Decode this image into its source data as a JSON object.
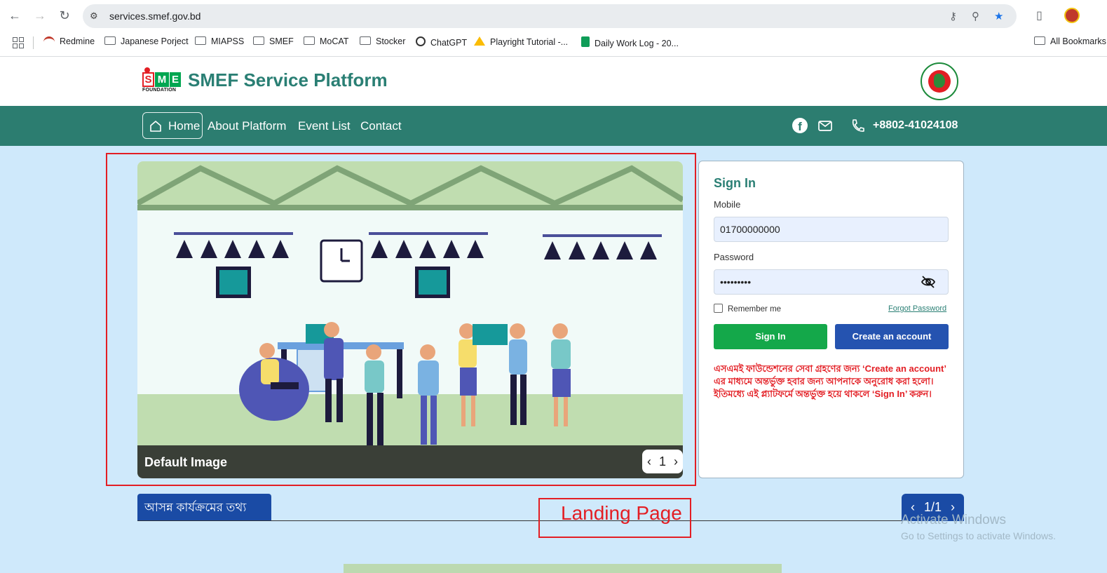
{
  "browser": {
    "url": "services.smef.gov.bd",
    "bookmarks": [
      "Redmine",
      "Japanese Porject",
      "MIAPSS",
      "SMEF",
      "MoCAT",
      "Stocker",
      "ChatGPT",
      "Playright Tutorial -...",
      "Daily Work Log - 20...",
      "All Bookmarks"
    ]
  },
  "header": {
    "logo_text": "SME",
    "logo_sub": "FOUNDATION",
    "title": "SMEF Service Platform"
  },
  "nav": {
    "home": "Home",
    "about": "About Platform",
    "events": "Event List",
    "contact": "Contact",
    "phone": "+8802-41024108"
  },
  "carousel": {
    "caption": "Default Image",
    "page": "1"
  },
  "signin": {
    "title": "Sign In",
    "mobile_label": "Mobile",
    "mobile_value": "01700000000",
    "password_label": "Password",
    "password_value": "•••••••••",
    "remember": "Remember me",
    "forgot": "Forgot Password",
    "signin_button": "Sign In",
    "create_button": "Create an account",
    "notice": "এসএমই ফাউন্ডেশনের সেবা গ্রহণের জন্য ‘Create an account’ এর মাধ্যমে অন্তর্ভুক্ত হবার জন্য আপনাকে অনুরোধ করা হলো। ইতিমধ্যে এই প্ল্যাটফর্মে অন্তর্ভুক্ত হয়ে থাকলে ‘Sign In’ করুন।"
  },
  "upcoming": {
    "tab_label": "আসন্ন কার্যক্রমের তথ্য",
    "pager": "1/1"
  },
  "annotation": "Landing Page",
  "watermark": {
    "line1": "Activate Windows",
    "line2": "Go to Settings to activate Windows."
  },
  "colors": {
    "brand": "#2c7d70",
    "accent_green": "#14a84a",
    "accent_blue": "#2553b0",
    "alert_red": "#e31e24"
  }
}
